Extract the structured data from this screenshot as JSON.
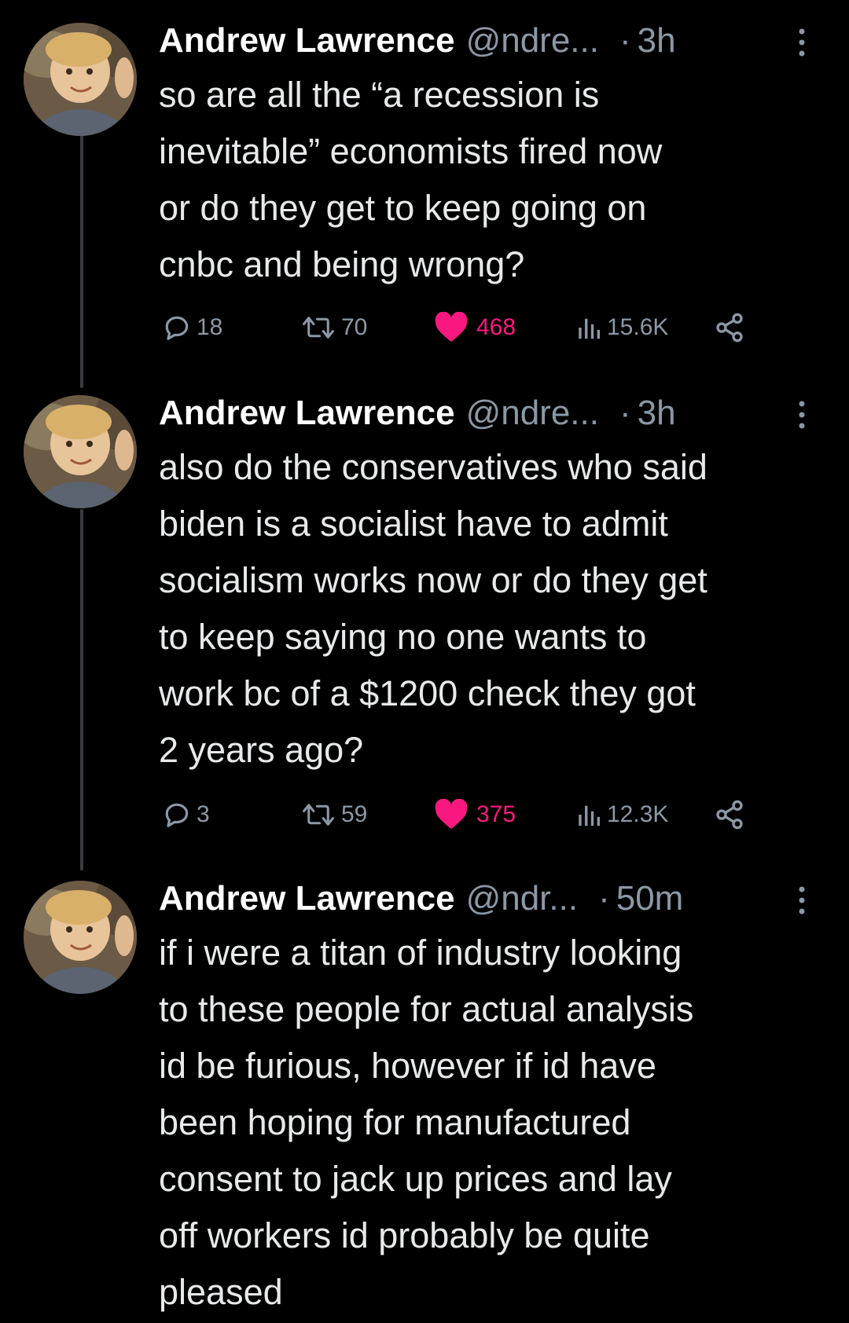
{
  "colors": {
    "background": "#000000",
    "text": "#e7e9ea",
    "secondary": "#8b98a5",
    "like": "#f91880",
    "thread_line": "#3a3d40"
  },
  "tweets": [
    {
      "display_name": "Andrew Lawrence",
      "handle": "@ndre...",
      "separator": "·",
      "time": "3h",
      "text": "so are all the “a recession is\ninevitable” economists fired now\nor do they get to keep going on\ncnbc and being wrong?",
      "replies": "18",
      "retweets": "70",
      "likes": "468",
      "views": "15.6K",
      "liked": true
    },
    {
      "display_name": "Andrew Lawrence",
      "handle": "@ndre...",
      "separator": "·",
      "time": "3h",
      "text": "also do the conservatives who said\nbiden is a socialist have to admit\nsocialism works now or do they get\nto keep saying no one wants to\nwork bc of a $1200 check they got\n2 years ago?",
      "replies": "3",
      "retweets": "59",
      "likes": "375",
      "views": "12.3K",
      "liked": true
    },
    {
      "display_name": "Andrew Lawrence",
      "handle": "@ndr...",
      "separator": "·",
      "time": "50m",
      "text": "if i were a titan of industry looking\nto these people for actual analysis\nid be furious, however if id have\nbeen hoping for manufactured\nconsent to jack up prices and lay\noff workers id probably be quite\npleased"
    }
  ],
  "icons": {
    "avatar": "avatar-photo",
    "more": "more-vertical-icon",
    "reply": "reply-icon",
    "retweet": "retweet-icon",
    "like": "heart-icon",
    "views": "views-icon",
    "share": "share-icon"
  }
}
